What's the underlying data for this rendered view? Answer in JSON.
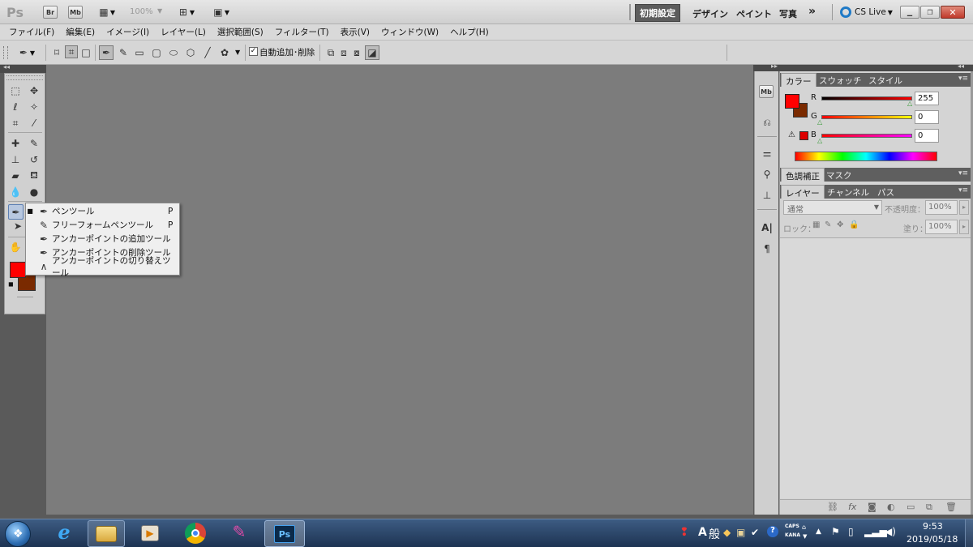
{
  "app": {
    "logo": "Ps",
    "br": "Br",
    "mb": "Mb",
    "zoom": "100%"
  },
  "workspaces": {
    "essentials": "初期設定",
    "design": "デザイン",
    "painting": "ペイント",
    "photography": "写真",
    "more": "»",
    "cslive": "CS Live"
  },
  "menu": [
    "ファイル(F)",
    "編集(E)",
    "イメージ(I)",
    "レイヤー(L)",
    "選択範囲(S)",
    "フィルター(T)",
    "表示(V)",
    "ウィンドウ(W)",
    "ヘルプ(H)"
  ],
  "options": {
    "auto_add_delete": "自動追加･削除"
  },
  "toolflyout": {
    "items": [
      {
        "label": "ペンツール",
        "shortcut": "P",
        "selected": true
      },
      {
        "label": "フリーフォームペンツール",
        "shortcut": "P",
        "selected": false
      },
      {
        "label": "アンカーポイントの追加ツール",
        "shortcut": "",
        "selected": false
      },
      {
        "label": "アンカーポイントの削除ツール",
        "shortcut": "",
        "selected": false
      },
      {
        "label": "アンカーポイントの切り替えツール",
        "shortcut": "",
        "selected": false
      }
    ]
  },
  "colors": {
    "foreground": "#ff0000",
    "background": "#7a2a00"
  },
  "color_panel": {
    "tabs": [
      "カラー",
      "スウォッチ",
      "スタイル"
    ],
    "r_label": "R",
    "g_label": "G",
    "b_label": "B",
    "r": "255",
    "g": "0",
    "b": "0"
  },
  "adjust_panel": {
    "tabs": [
      "色調補正",
      "マスク"
    ]
  },
  "layers_panel": {
    "tabs": [
      "レイヤー",
      "チャンネル",
      "パス"
    ],
    "blend_mode": "通常",
    "opacity_label": "不透明度：",
    "opacity": "100%",
    "lock_label": "ロック：",
    "fill_label": "塗り：",
    "fill": "100%"
  },
  "tray": {
    "ime_a": "A",
    "ime_mode": "般",
    "caps": "CAPS",
    "kana": "KANA",
    "time": "9:53",
    "date": "2019/05/18"
  }
}
